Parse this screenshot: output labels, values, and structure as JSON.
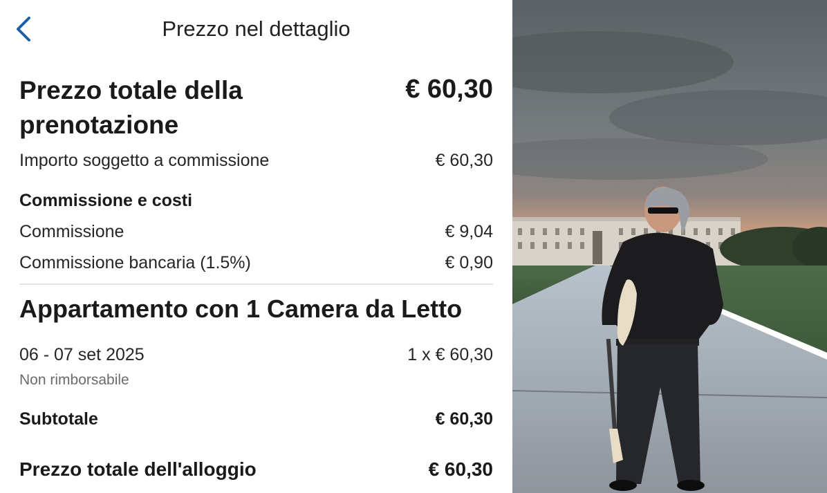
{
  "header": {
    "title": "Prezzo nel dettaglio"
  },
  "summary": {
    "total_title": "Prezzo totale della prenotazione",
    "total_amount": "€ 60,30",
    "taxable_label": "Importo soggetto a commissione",
    "taxable_amount": "€ 60,30"
  },
  "fees": {
    "heading": "Commissione e costi",
    "items": [
      {
        "label": "Commissione",
        "amount": "€ 9,04"
      },
      {
        "label": "Commissione bancaria (1.5%)",
        "amount": "€ 0,90"
      }
    ]
  },
  "room": {
    "title": "Appartamento con 1 Camera da Letto",
    "dates": "06 - 07 set 2025",
    "price_line": "1 x € 60,30",
    "policy": "Non rimborsabile"
  },
  "subtotal": {
    "label": "Subtotale",
    "amount": "€ 60,30"
  },
  "accommodation_total": {
    "label": "Prezzo totale dell'alloggio",
    "amount": "€ 60,30"
  },
  "colors": {
    "accent": "#1f5fa8",
    "divider": "#e3e3e3"
  },
  "icons": {
    "back": "chevron-left-icon"
  }
}
